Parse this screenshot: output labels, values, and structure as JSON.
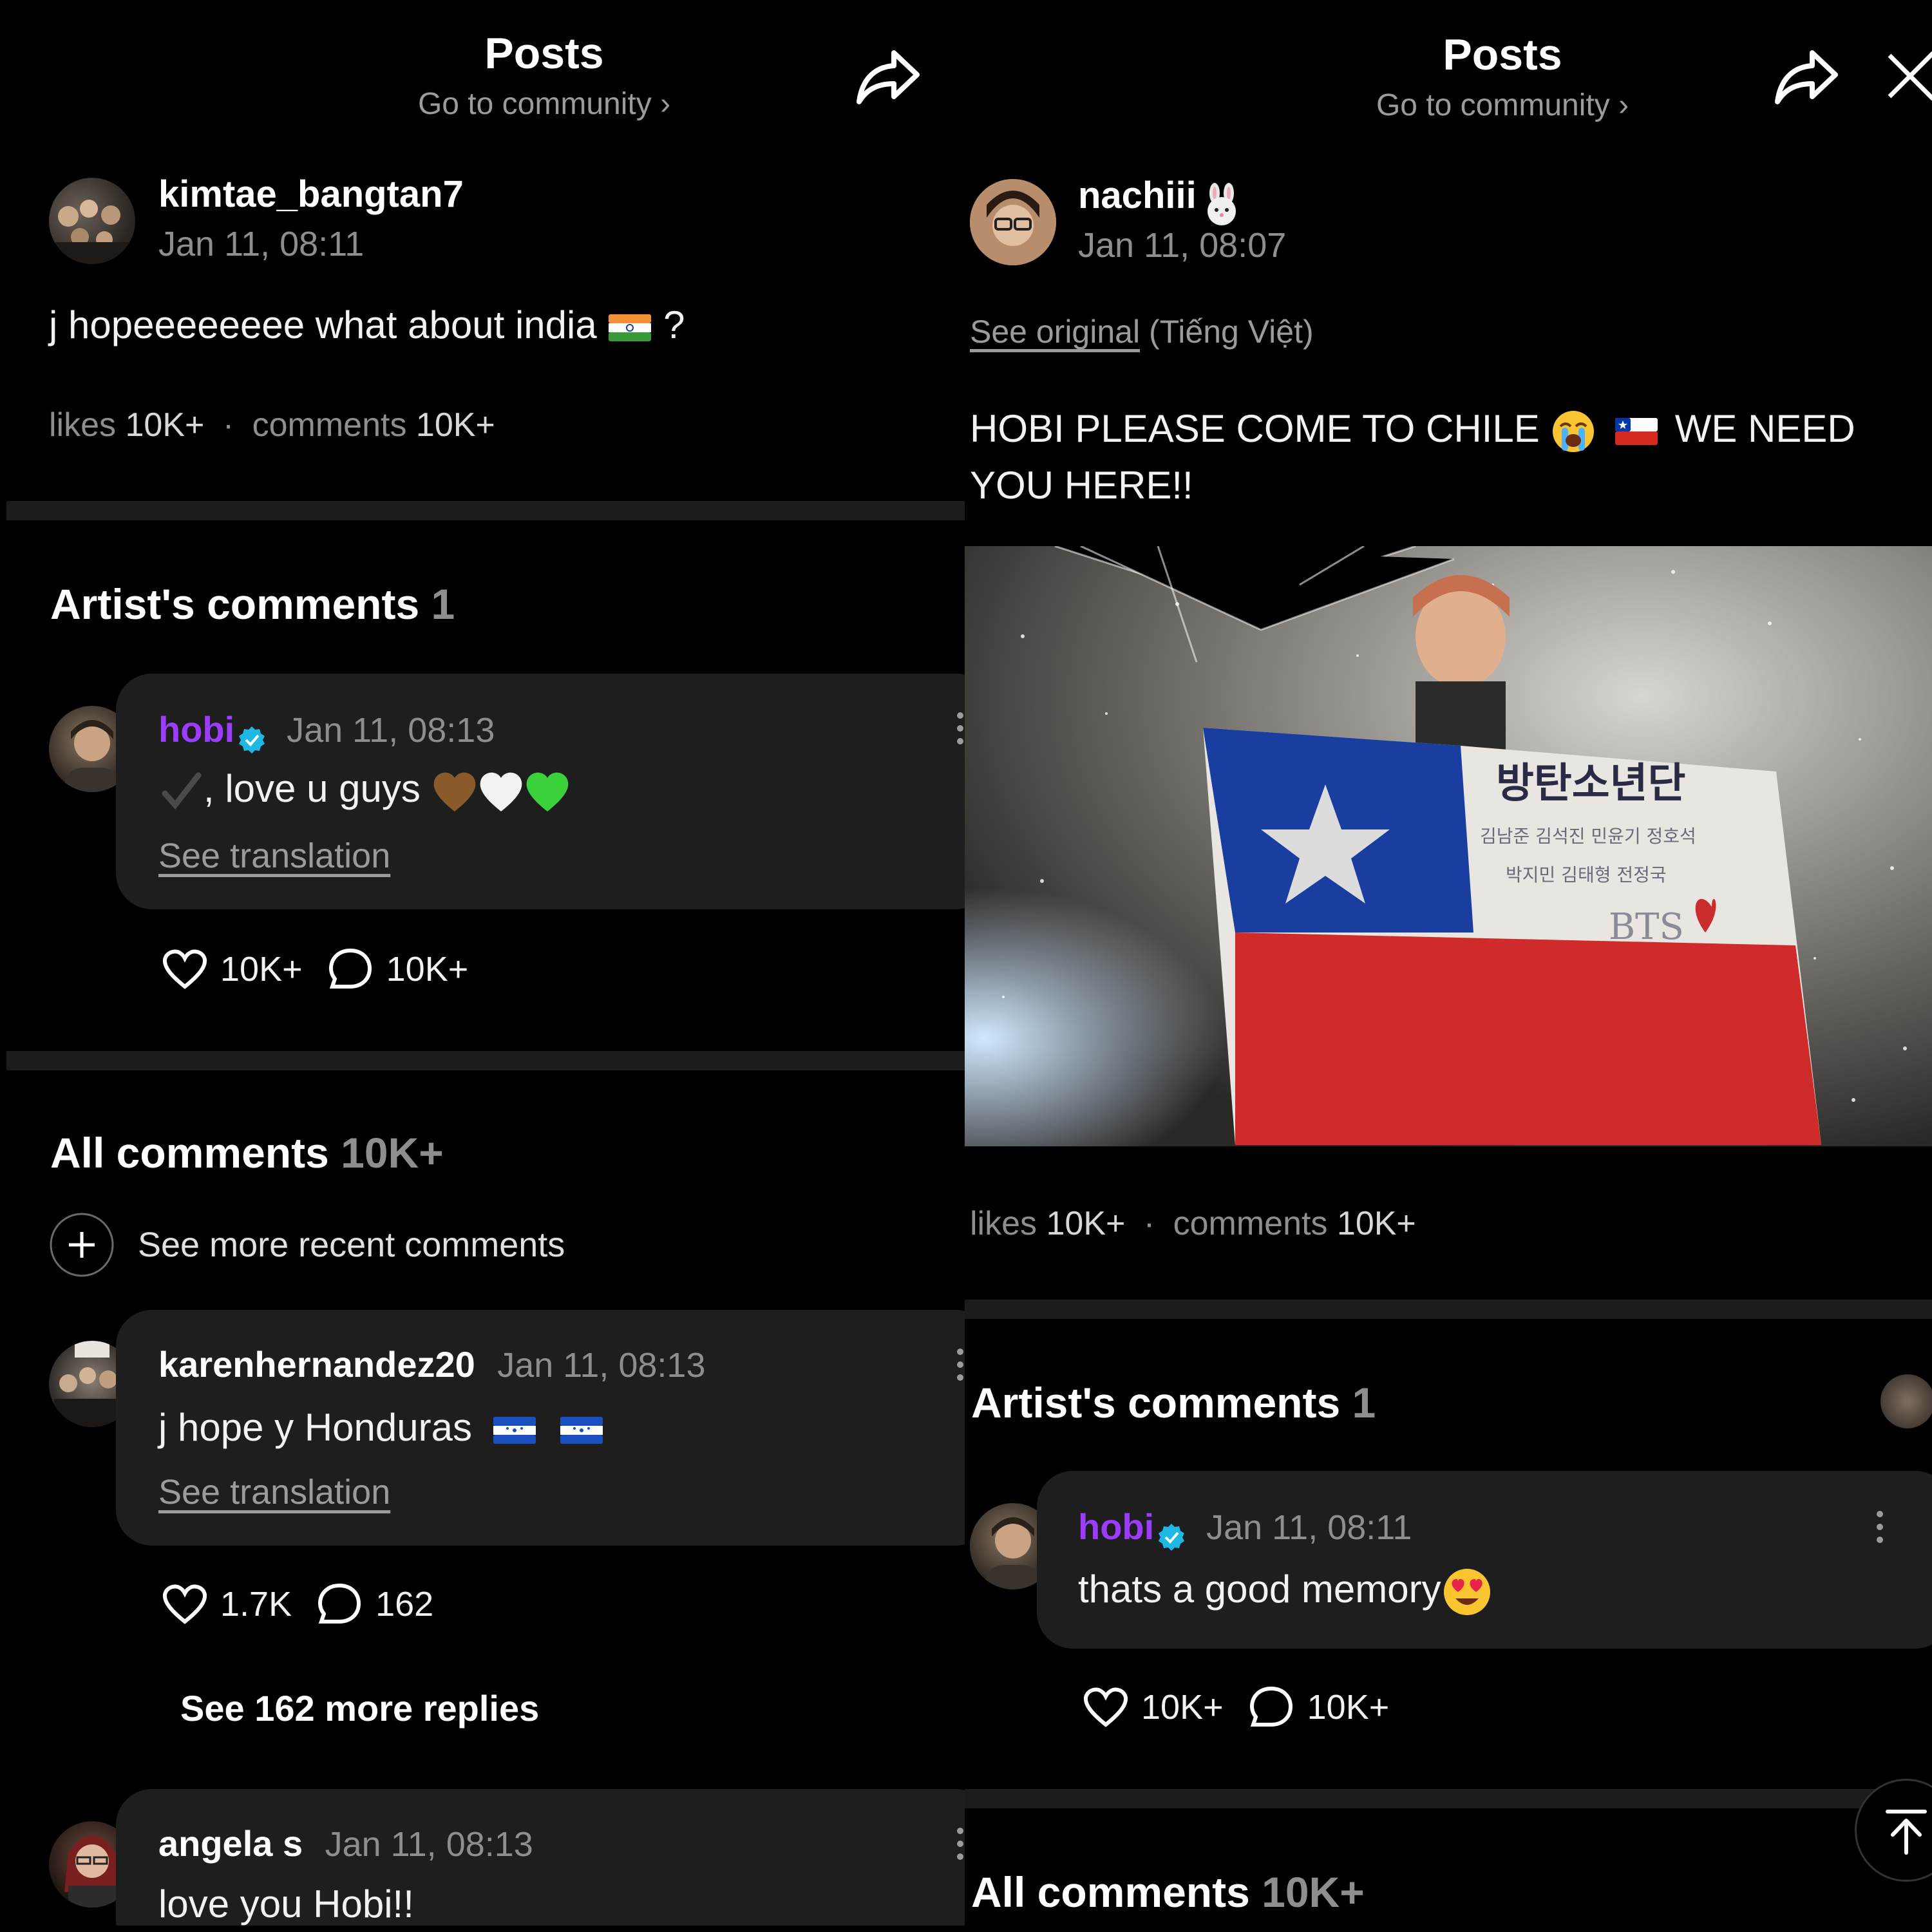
{
  "left": {
    "header": {
      "title": "Posts",
      "subtitle": "Go to community ›"
    },
    "post": {
      "username": "kimtae_bangtan7",
      "date": "Jan 11, 08:11",
      "text": "j hopeeeeeeee what about india",
      "text_tail": "?",
      "likes_label": "likes",
      "likes": "10K+",
      "comments_label": "comments",
      "comments": "10K+"
    },
    "artist_comments": {
      "title": "Artist's comments",
      "count": "1",
      "comment": {
        "username": "hobi",
        "date": "Jan 11, 08:13",
        "text": ", love u guys",
        "see_translation": "See translation",
        "likes": "10K+",
        "replies": "10K+"
      }
    },
    "all_comments": {
      "title": "All comments",
      "count": "10K+",
      "see_more": "See more recent comments",
      "comments": [
        {
          "username": "karenhernandez20",
          "date": "Jan 11, 08:13",
          "text": "j hope y Honduras",
          "see_translation": "See translation",
          "likes": "1.7K",
          "replies": "162",
          "more_replies": "See 162 more replies"
        },
        {
          "username": "angela s",
          "date": "Jan 11, 08:13",
          "text": "love you Hobi!!"
        }
      ]
    }
  },
  "right": {
    "header": {
      "title": "Posts",
      "subtitle": "Go to community ›"
    },
    "post": {
      "username": "nachiii",
      "date": "Jan 11, 08:07",
      "see_original": "See original",
      "language": "(Tiếng Việt)",
      "text_line1": "HOBI PLEASE COME TO CHILE",
      "text_line1_tail": "WE NEED",
      "text_line2": "YOU HERE!!",
      "likes_label": "likes",
      "likes": "10K+",
      "comments_label": "comments",
      "comments": "10K+",
      "photo": {
        "flag_text_1": "방탄소년단",
        "flag_text_2": "김남준 김석진 민윤기 정호석",
        "flag_text_3": "박지민 김태형 전정국",
        "flag_text_4": "BTS"
      }
    },
    "artist_comments": {
      "title": "Artist's comments",
      "count": "1",
      "comment": {
        "username": "hobi",
        "date": "Jan 11, 08:11",
        "text": "thats a good memory",
        "likes": "10K+",
        "replies": "10K+"
      }
    },
    "all_comments": {
      "title": "All comments",
      "count": "10K+"
    }
  },
  "colors": {
    "background": "#000000",
    "artist_name": "#9b3cff",
    "verified_badge": "#1fb8e6",
    "muted_text": "#8e8e8e",
    "bubble": "#1e1e1e"
  }
}
